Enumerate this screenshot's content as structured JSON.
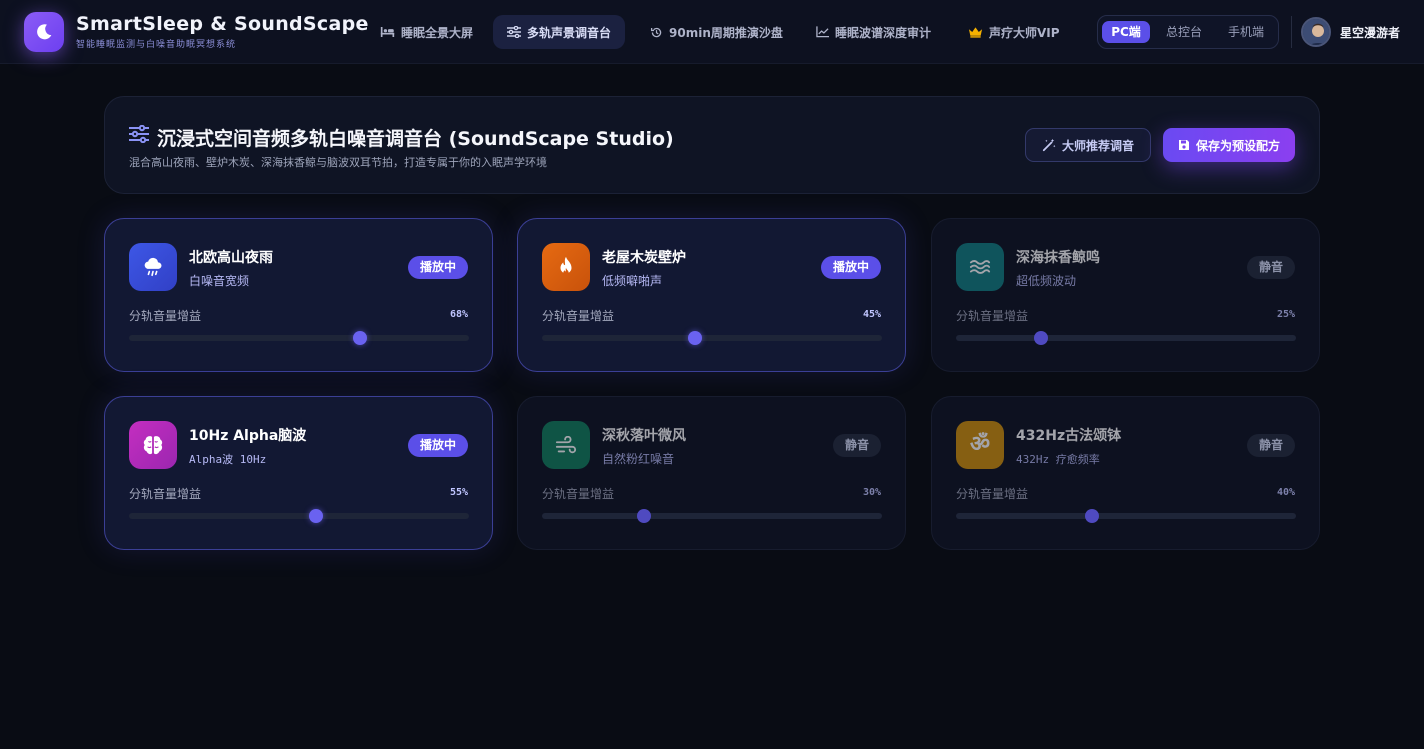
{
  "brand": {
    "title": "SmartSleep & SoundScape",
    "subtitle": "智能睡眠监测与白噪音助眠冥想系统"
  },
  "nav": {
    "items": [
      {
        "label": "睡眠全景大屏",
        "icon": "bed-icon"
      },
      {
        "label": "多轨声景调音台",
        "icon": "sliders-icon",
        "active": true
      },
      {
        "label": "90min周期推演沙盘",
        "icon": "history-icon"
      },
      {
        "label": "睡眠波谱深度审计",
        "icon": "chart-line-icon"
      },
      {
        "label": "声疗大师VIP",
        "icon": "crown-icon"
      }
    ],
    "platform": {
      "options": [
        "PC端",
        "总控台",
        "手机端"
      ],
      "selected": "PC端"
    }
  },
  "user": {
    "name": "星空漫游者"
  },
  "studio": {
    "title": "沉浸式空间音频多轨白噪音调音台 (SoundScape Studio)",
    "subtitle": "混合高山夜雨、壁炉木炭、深海抹香鲸与脑波双耳节拍，打造专属于你的入眠声学环境",
    "recommend_label": "大师推荐调音",
    "save_label": "保存为预设配方"
  },
  "gain_label": "分轨音量增益",
  "tracks": [
    {
      "name": "北欧高山夜雨",
      "desc": "白噪音宽频",
      "status": "播放中",
      "playing": true,
      "gain": 68,
      "gain_text": "68%",
      "icon": "cloud-rain-icon",
      "color": "#3a52e0"
    },
    {
      "name": "老屋木炭壁炉",
      "desc": "低频噼啪声",
      "status": "播放中",
      "playing": true,
      "gain": 45,
      "gain_text": "45%",
      "icon": "fire-icon",
      "color": "#e2610f"
    },
    {
      "name": "深海抹香鲸鸣",
      "desc": "超低频波动",
      "status": "静音",
      "playing": false,
      "gain": 25,
      "gain_text": "25%",
      "icon": "water-icon",
      "color": "#127b80"
    },
    {
      "name": "10Hz Alpha脑波",
      "desc": "Alpha波 10Hz",
      "status": "播放中",
      "playing": true,
      "gain": 55,
      "gain_text": "55%",
      "icon": "brain-icon",
      "color": "#b42ab8"
    },
    {
      "name": "深秋落叶微风",
      "desc": "自然粉红噪音",
      "status": "静音",
      "playing": false,
      "gain": 30,
      "gain_text": "30%",
      "icon": "wind-icon",
      "color": "#137a5c"
    },
    {
      "name": "432Hz古法颂钵",
      "desc": "432Hz 疗愈频率",
      "status": "静音",
      "playing": false,
      "gain": 40,
      "gain_text": "40%",
      "icon": "om-icon",
      "color": "#c78a0b"
    }
  ],
  "colors": {
    "accent": "#5b4fe8",
    "background": "#090c14"
  }
}
